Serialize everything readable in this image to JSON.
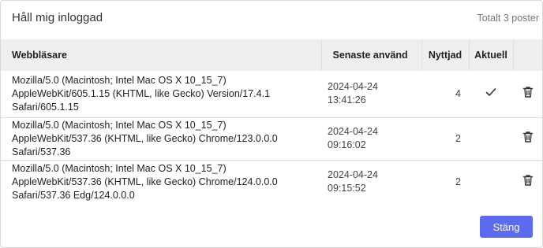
{
  "dialog": {
    "title": "Håll mig inloggad",
    "total": "Totalt 3 poster",
    "close_label": "Stäng"
  },
  "table": {
    "headers": {
      "browser": "Webbläsare",
      "last_used": "Senaste använd",
      "uses": "Nyttjad",
      "current": "Aktuell"
    },
    "rows": [
      {
        "browser": "Mozilla/5.0 (Macintosh; Intel Mac OS X 10_15_7) AppleWebKit/605.1.15 (KHTML, like Gecko) Version/17.4.1 Safari/605.1.15",
        "last_used": "2024-04-24 13:41:26",
        "uses": "4",
        "current": true
      },
      {
        "browser": "Mozilla/5.0 (Macintosh; Intel Mac OS X 10_15_7) AppleWebKit/537.36 (KHTML, like Gecko) Chrome/123.0.0.0 Safari/537.36",
        "last_used": "2024-04-24 09:16:02",
        "uses": "2",
        "current": false
      },
      {
        "browser": "Mozilla/5.0 (Macintosh; Intel Mac OS X 10_15_7) AppleWebKit/537.36 (KHTML, like Gecko) Chrome/124.0.0.0 Safari/537.36 Edg/124.0.0.0",
        "last_used": "2024-04-24 09:15:52",
        "uses": "2",
        "current": false
      }
    ]
  },
  "icons": {
    "current": "check-icon",
    "delete": "trash-icon"
  },
  "colors": {
    "primary_button": "#5b6cf0",
    "header_bg": "#efefef"
  }
}
